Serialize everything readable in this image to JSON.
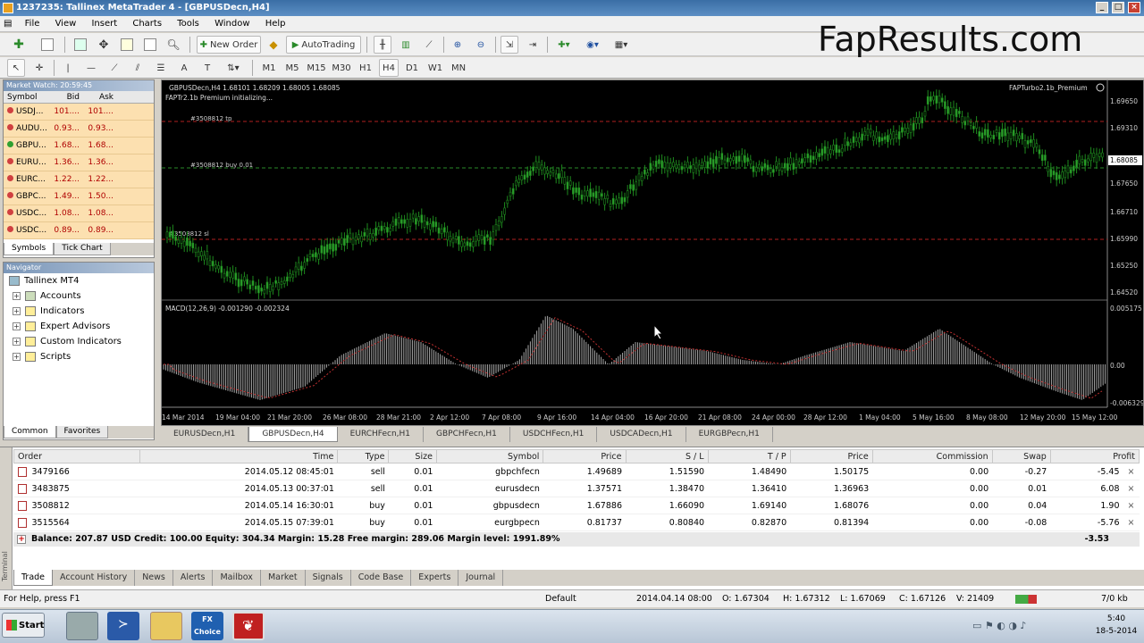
{
  "window": {
    "title": "1237235: Tallinex MetaTrader 4 - [GBPUSDecn,H4]"
  },
  "menu": [
    "File",
    "View",
    "Insert",
    "Charts",
    "Tools",
    "Window",
    "Help"
  ],
  "toolbar": {
    "new_order": "New Order",
    "autotrading": "AutoTrading"
  },
  "timeframes": [
    "M1",
    "M5",
    "M15",
    "M30",
    "H1",
    "H4",
    "D1",
    "W1",
    "MN"
  ],
  "watermark": "FapResults.com",
  "market_watch": {
    "title": "Market Watch: 20:59:45",
    "headers": {
      "symbol": "Symbol",
      "bid": "Bid",
      "ask": "Ask"
    },
    "rows": [
      {
        "symbol": "USDJ...",
        "bid": "101....",
        "ask": "101....",
        "dot": "#d04040"
      },
      {
        "symbol": "AUDU...",
        "bid": "0.93...",
        "ask": "0.93...",
        "dot": "#d04040"
      },
      {
        "symbol": "GBPU...",
        "bid": "1.68...",
        "ask": "1.68...",
        "dot": "#30a030"
      },
      {
        "symbol": "EURU...",
        "bid": "1.36...",
        "ask": "1.36...",
        "dot": "#d04040"
      },
      {
        "symbol": "EURC...",
        "bid": "1.22...",
        "ask": "1.22...",
        "dot": "#d04040"
      },
      {
        "symbol": "GBPC...",
        "bid": "1.49...",
        "ask": "1.50...",
        "dot": "#d04040"
      },
      {
        "symbol": "USDC...",
        "bid": "1.08...",
        "ask": "1.08...",
        "dot": "#d04040"
      },
      {
        "symbol": "USDC...",
        "bid": "0.89...",
        "ask": "0.89...",
        "dot": "#d04040"
      }
    ],
    "tabs": [
      "Symbols",
      "Tick Chart"
    ]
  },
  "navigator": {
    "title": "Navigator",
    "root": "Tallinex MT4",
    "items": [
      "Accounts",
      "Indicators",
      "Expert Advisors",
      "Custom Indicators",
      "Scripts"
    ],
    "tabs": [
      "Common",
      "Favorites"
    ]
  },
  "chart": {
    "header": "GBPUSDecn,H4  1.68101 1.68209 1.68005 1.68085",
    "ea_label": "FAPTurbo2.1b_Premium",
    "ea_status": "FAPTr2.1b Premium initializing...",
    "line_tp": "#3508812 tp",
    "line_buy": "#3508812 buy 0.01",
    "line_sl": "#3508812 sl",
    "price_labels": [
      "1.69650",
      "1.69310",
      "1.68085",
      "1.67650",
      "1.66710",
      "1.65990",
      "1.65250",
      "1.64520"
    ],
    "macd_label": "MACD(12,26,9) -0.001290 -0.002324",
    "macd_labels": [
      "0.005175",
      "0.00",
      "-0.006329"
    ],
    "time_labels": [
      "14 Mar 2014",
      "19 Mar 04:00",
      "21 Mar 20:00",
      "26 Mar 08:00",
      "28 Mar 21:00",
      "2 Apr 12:00",
      "7 Apr 08:00",
      "9 Apr 16:00",
      "14 Apr 04:00",
      "16 Apr 20:00",
      "21 Apr 08:00",
      "24 Apr 00:00",
      "28 Apr 12:00",
      "1 May 04:00",
      "5 May 16:00",
      "8 May 08:00",
      "12 May 20:00",
      "15 May 12:00"
    ],
    "tabs": [
      "EURUSDecn,H1",
      "GBPUSDecn,H4",
      "EURCHFecn,H1",
      "GBPCHFecn,H1",
      "USDCHFecn,H1",
      "USDCADecn,H1",
      "EURGBPecn,H1"
    ],
    "active_tab": 1
  },
  "terminal": {
    "headers": [
      "Order",
      "Time",
      "Type",
      "Size",
      "Symbol",
      "Price",
      "S / L",
      "T / P",
      "Price",
      "Commission",
      "Swap",
      "Profit"
    ],
    "rows": [
      [
        "3479166",
        "2014.05.12 08:45:01",
        "sell",
        "0.01",
        "gbpchfecn",
        "1.49689",
        "1.51590",
        "1.48490",
        "1.50175",
        "0.00",
        "-0.27",
        "-5.45"
      ],
      [
        "3483875",
        "2014.05.13 00:37:01",
        "sell",
        "0.01",
        "eurusdecn",
        "1.37571",
        "1.38470",
        "1.36410",
        "1.36963",
        "0.00",
        "0.01",
        "6.08"
      ],
      [
        "3508812",
        "2014.05.14 16:30:01",
        "buy",
        "0.01",
        "gbpusdecn",
        "1.67886",
        "1.66090",
        "1.69140",
        "1.68076",
        "0.00",
        "0.04",
        "1.90"
      ],
      [
        "3515564",
        "2014.05.15 07:39:01",
        "buy",
        "0.01",
        "eurgbpecn",
        "0.81737",
        "0.80840",
        "0.82870",
        "0.81394",
        "0.00",
        "-0.08",
        "-5.76"
      ]
    ],
    "balance": "Balance: 207.87 USD  Credit: 100.00  Equity: 304.34  Margin: 15.28  Free margin: 289.06  Margin level: 1991.89%",
    "total": "-3.53",
    "side_label": "Terminal",
    "tabs": [
      "Trade",
      "Account History",
      "News",
      "Alerts",
      "Mailbox",
      "Market",
      "Signals",
      "Code Base",
      "Experts",
      "Journal"
    ]
  },
  "status": {
    "help": "For Help, press F1",
    "profile": "Default",
    "datetime": "2014.04.14 08:00",
    "open": "O: 1.67304",
    "high": "H: 1.67312",
    "low": "L: 1.67069",
    "close": "C: 1.67126",
    "volume": "V: 21409",
    "traffic": "7/0 kb"
  },
  "taskbar": {
    "start": "Start",
    "time": "5:40",
    "date": "18-5-2014",
    "fx_label": "FX Choice"
  }
}
